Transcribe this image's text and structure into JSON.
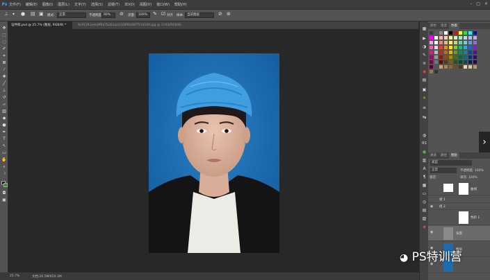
{
  "app": {
    "logo": "Ps"
  },
  "menu": [
    "文件(F)",
    "编辑(E)",
    "图像(I)",
    "图层(L)",
    "文字(Y)",
    "选择(S)",
    "滤镜(T)",
    "3D(D)",
    "视图(V)",
    "窗口(W)",
    "帮助(H)"
  ],
  "options": {
    "mode_label": "模式:",
    "mode_value": "正常",
    "opacity_label": "不透明度:",
    "opacity_value": "90%",
    "flow_label": "流量:",
    "flow_value": "100%",
    "aligned_label": "对齐",
    "sample_label": "样本:",
    "sample_value": "当前图层"
  },
  "tabs": [
    "证件照.psd @ 25.7% (图层, RGB/8) *",
    "9c41241eda9f6d7bab1aa1328f8a0bf7514169.jpg @ 1143(RGB/8)"
  ],
  "status": {
    "zoom": "25.7%",
    "doc_size": "文档:26.5M/659.3M"
  },
  "strip": {
    "rs": "RS"
  },
  "swatch_panel": {
    "tabs": [
      "颜色",
      "渐变",
      "色板"
    ],
    "colors": [
      "#3a3a3a",
      "#5a5a5a",
      "#888888",
      "#ffffff",
      "#000000",
      "#ff0000",
      "#ffff00",
      "#00ff00",
      "#00ffff",
      "#0000ff",
      "#ff00ff",
      "#ffffff",
      "#f2b8a8",
      "#f6d6a8",
      "#fff3a8",
      "#d6f0a8",
      "#a8e8c8",
      "#a8e0f0",
      "#a8c0f0",
      "#c8a8f0",
      "#f0a8d8",
      "#ffffff",
      "#ee8866",
      "#f4b866",
      "#fff066",
      "#b8e066",
      "#66d8a8",
      "#66d0ea",
      "#6698e0",
      "#a066e0",
      "#e066b8",
      "#dddddd",
      "#e0442a",
      "#ee8a22",
      "#ffe022",
      "#88cc22",
      "#22b878",
      "#22b0d8",
      "#2266cc",
      "#7a22cc",
      "#cc2288",
      "#bbbbbb",
      "#c22a14",
      "#cc6a0a",
      "#e0b80a",
      "#5aa80a",
      "#0a9058",
      "#0a88b0",
      "#0a44a0",
      "#5a0aa0",
      "#a00a66",
      "#999999",
      "#8a1a0a",
      "#9a4a04",
      "#a88a04",
      "#3a7a04",
      "#046a40",
      "#046a88",
      "#043078",
      "#3a0478",
      "#780448",
      "#777777",
      "#5a0e04",
      "#6a3202",
      "#7a6402",
      "#285802",
      "#024a2c",
      "#024a62",
      "#021e56",
      "#280256",
      "#560232",
      "#555555",
      "#c8a478",
      "#a8845a",
      "#8a6a44",
      "#6a4e30",
      "#4e3620",
      "#e8d8b8",
      "#d8c098",
      "#b89868",
      "#987844",
      "#333333"
    ]
  },
  "layers_panel": {
    "tabs": [
      "通道",
      "路径",
      "图层"
    ],
    "filter": "类型",
    "blend_mode": "正常",
    "opacity": "不透明度: 100%",
    "lock": "锁定:",
    "fill": "填充: 100%"
  },
  "layers": [
    "曲线",
    "组 1",
    "组 2",
    "色阶 1",
    "背景",
    "图层"
  ],
  "watermark": {
    "text": "PS特训营"
  }
}
